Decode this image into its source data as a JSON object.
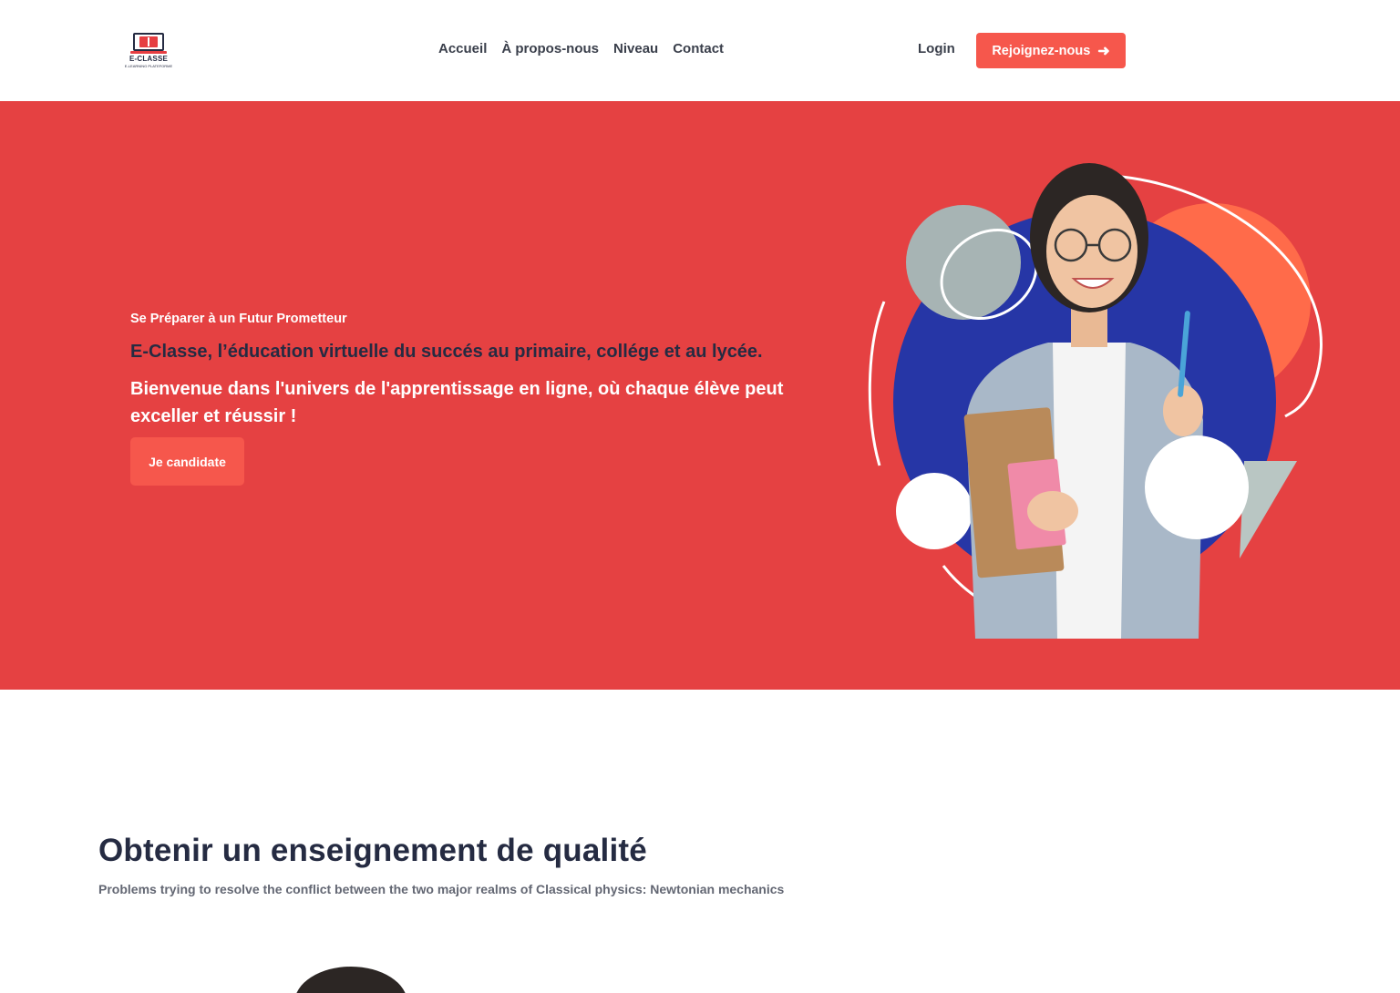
{
  "header": {
    "logo": {
      "name": "E-CLASSE",
      "tagline": "E-LEARNING PLATEFORME"
    },
    "nav": [
      "Accueil",
      "À propos-nous",
      "Niveau",
      "Contact"
    ],
    "login_label": "Login",
    "join_label": "Rejoignez-nous"
  },
  "hero": {
    "subtitle": "Se Préparer à un Futur Prometteur",
    "title": "E-Classe, l’éducation virtuelle du succés au primaire, collége et au lycée.",
    "text": "Bienvenue dans l'univers de l'apprentissage en ligne, où chaque élève peut exceller et réussir !",
    "cta_label": "Je candidate"
  },
  "section": {
    "title": "Obtenir un enseignement de qualité",
    "subtitle": "Problems trying to resolve the conflict between the two major realms of Classical physics: Newtonian mechanics"
  },
  "colors": {
    "hero_bg": "#e54142",
    "button": "#f6574c",
    "dark_text": "#252b42",
    "blue_circle": "#2636a6",
    "orange_circle": "#ff6b4a",
    "grey_shape": "#a7b4b4"
  },
  "icons": [
    "arrow-right-icon",
    "laptop-book-logo"
  ]
}
